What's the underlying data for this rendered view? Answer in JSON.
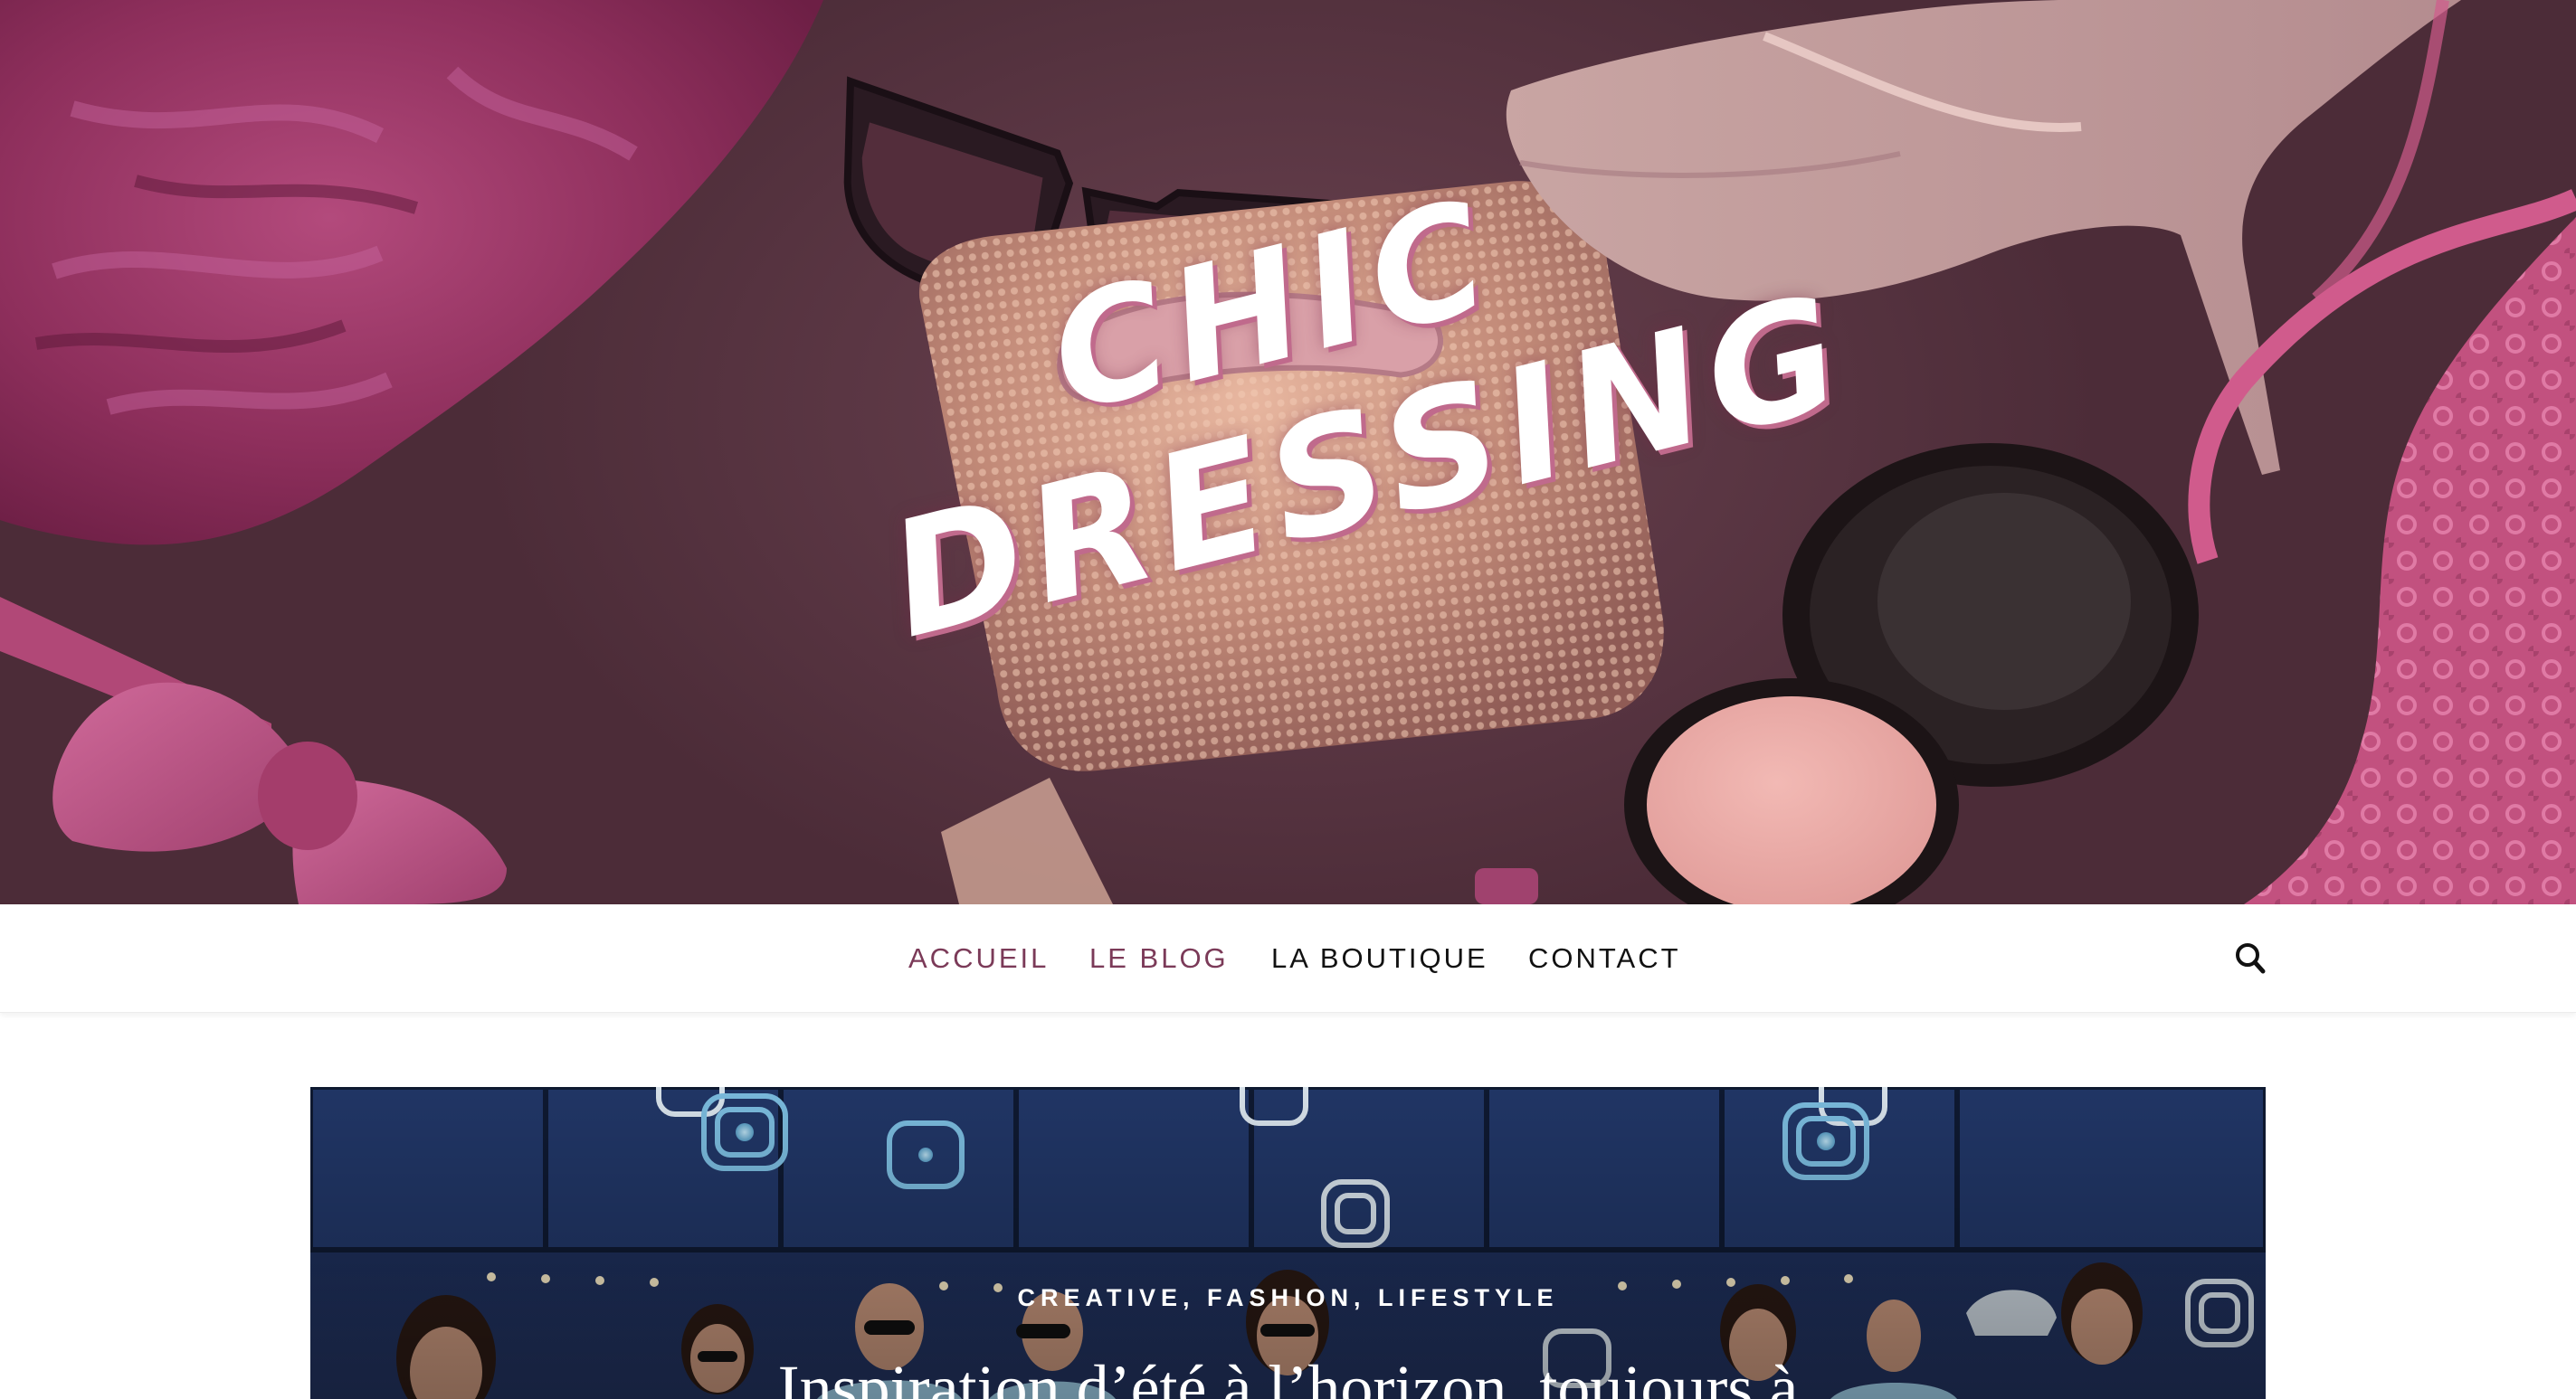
{
  "site": {
    "logo_line1": "CHIC",
    "logo_line2": "DRESSING"
  },
  "nav": {
    "items": [
      {
        "label": "ACCUEIL",
        "active": true
      },
      {
        "label": "LE BLOG",
        "active": true
      },
      {
        "label": "LA BOUTIQUE",
        "active": false
      },
      {
        "label": "CONTACT",
        "active": false
      }
    ],
    "search_icon": "search-icon"
  },
  "featured_post": {
    "categories": "CREATIVE, FASHION, LIFESTYLE",
    "title": "Inspiration d’été à l’horizon, toujours à"
  },
  "colors": {
    "accent": "#7b3a58",
    "hero_background": "#5a3643",
    "nav_text": "#111111",
    "feature_background": "#1c2f5c"
  }
}
